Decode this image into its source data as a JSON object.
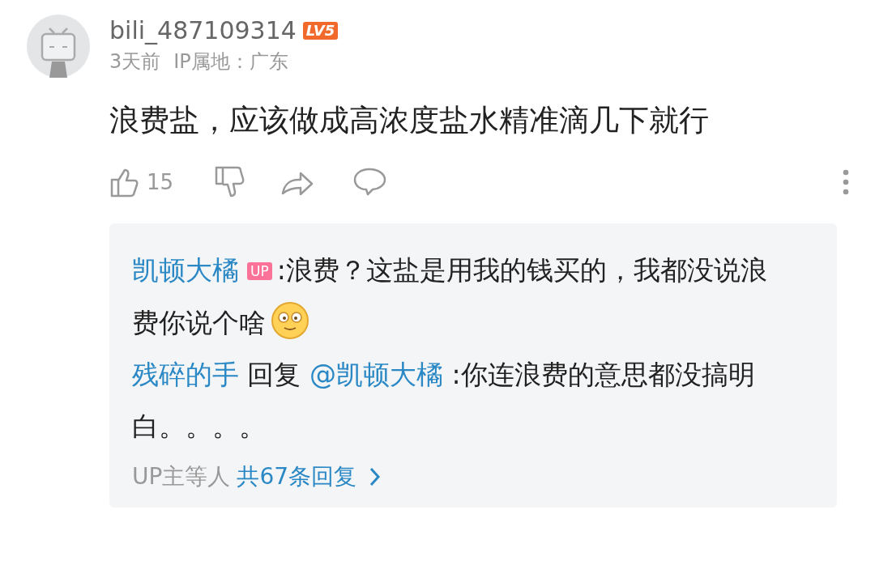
{
  "comment": {
    "author": "bili_487109314",
    "level_badge": "LV5",
    "time": "3天前",
    "ip_location": "IP属地：广东",
    "text": "浪费盐，应该做成高浓度盐水精准滴几下就行",
    "like_count": "15",
    "replies": [
      {
        "author": "凯顿大橘",
        "badge": "UP",
        "text": ":浪费？这盐是用我的钱买的，我都没说浪费你说个啥",
        "emoji": true
      },
      {
        "author": "残碎的手",
        "reply_word": "回复",
        "mention": "@凯顿大橘",
        "text": ":你连浪费的意思都没搞明白。。。。",
        "emoji": false
      }
    ],
    "more_prefix": "UP主等人",
    "more_link": "共67条回复"
  }
}
